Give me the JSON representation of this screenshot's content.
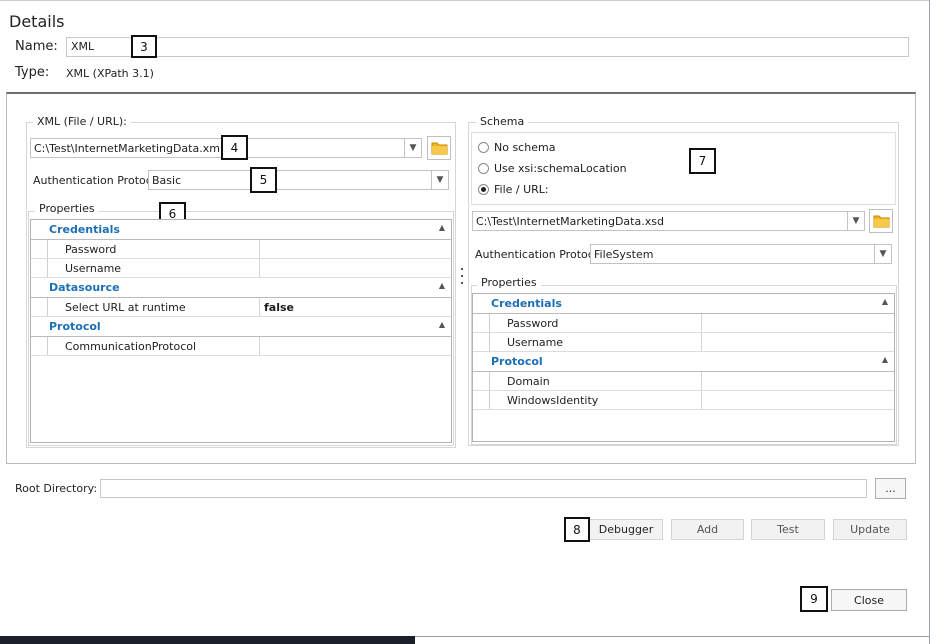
{
  "details": {
    "title": "Details",
    "name_label": "Name:",
    "name_value": "XML",
    "type_label": "Type:",
    "type_value": "XML (XPath 3.1)"
  },
  "callouts": [
    "3",
    "4",
    "5",
    "6",
    "7",
    "8",
    "9"
  ],
  "xml_source": {
    "group_title": "XML (File / URL):",
    "path": "C:\\Test\\InternetMarketingData.xml",
    "auth_label": "Authentication Protocol",
    "auth_value": "Basic",
    "properties_title": "Properties",
    "categories": [
      {
        "name": "Credentials",
        "props": [
          {
            "name": "Password",
            "value": ""
          },
          {
            "name": "Username",
            "value": ""
          }
        ]
      },
      {
        "name": "Datasource",
        "props": [
          {
            "name": "Select URL at runtime",
            "value": "false"
          }
        ]
      },
      {
        "name": "Protocol",
        "props": [
          {
            "name": "CommunicationProtocol",
            "value": ""
          }
        ]
      }
    ]
  },
  "schema": {
    "group_title": "Schema",
    "options": [
      "No schema",
      "Use xsi:schemaLocation",
      "File / URL:"
    ],
    "selected_option": "File / URL:",
    "path": "C:\\Test\\InternetMarketingData.xsd",
    "auth_label": "Authentication Protocol",
    "auth_value": "FileSystem",
    "properties_title": "Properties",
    "categories": [
      {
        "name": "Credentials",
        "props": [
          {
            "name": "Password",
            "value": ""
          },
          {
            "name": "Username",
            "value": ""
          }
        ]
      },
      {
        "name": "Protocol",
        "props": [
          {
            "name": "Domain",
            "value": ""
          },
          {
            "name": "WindowsIdentity",
            "value": ""
          }
        ]
      }
    ]
  },
  "root_directory": {
    "label": "Root Directory:",
    "value": "",
    "browse_label": "..."
  },
  "buttons": {
    "debugger": "Debugger",
    "add": "Add",
    "test": "Test",
    "update": "Update",
    "close": "Close"
  },
  "colors": {
    "category_text": "#1c6fb6",
    "folder_icon": "#f2b21b"
  }
}
